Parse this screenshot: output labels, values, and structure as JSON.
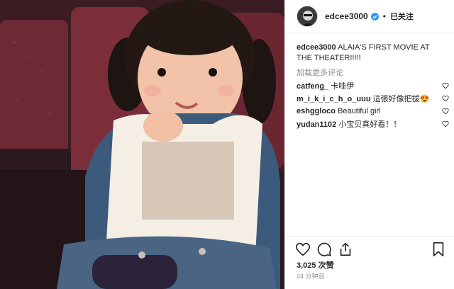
{
  "post": {
    "username": "edcee3000",
    "dot": "•",
    "follow_label": "已关注",
    "caption_user": "edcee3000",
    "caption_text": "ALAIA'S FIRST MOVIE AT THE THEATER!!!!!",
    "load_more": "加载更多评论",
    "likes": "3,025 次赞",
    "timestamp": "24 分钟前"
  },
  "comments": [
    {
      "user": "catfeng_",
      "text": "卡哇伊"
    },
    {
      "user": "m_i_k_i_c_h_o_uuu",
      "text": "這張好像把拔😍"
    },
    {
      "user": "eshggloco",
      "text": "Beautiful girl"
    },
    {
      "user": "yudan1102",
      "text": "小宝贝真好看！！"
    }
  ],
  "icons": {
    "verified": "verified-badge-icon",
    "like": "heart-icon",
    "comment": "comment-bubble-icon",
    "share": "share-icon",
    "save": "bookmark-icon"
  },
  "colors": {
    "text": "#262626",
    "muted": "#8e8e8e",
    "verified": "#3897f0",
    "border": "#efefef"
  }
}
